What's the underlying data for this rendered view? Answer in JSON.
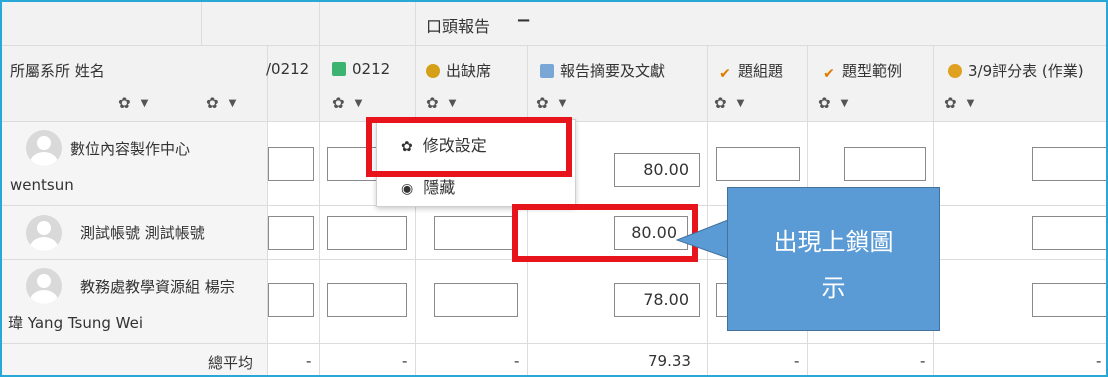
{
  "header": {
    "category_title": "口頭報告",
    "category_toggle": "−",
    "col_user_label": "所屬系所 姓名",
    "columns": [
      {
        "label": "/0212",
        "icon": "partial-label"
      },
      {
        "label": "0212",
        "icon": "forum-icon"
      },
      {
        "label": "出缺席",
        "icon": "attendance-icon"
      },
      {
        "label": "報告摘要及文獻",
        "icon": "assignment-icon"
      },
      {
        "label": "題組題",
        "icon": "quiz-icon"
      },
      {
        "label": "題型範例",
        "icon": "quiz-icon"
      },
      {
        "label": "3/9評分表 (作業)",
        "icon": "workshop-icon"
      }
    ],
    "gear_icon": "gear-icon",
    "caret_icon": "caret-down-icon"
  },
  "rows": [
    {
      "name_line1": "數位內容製作中心",
      "name_line2": "wentsun",
      "grade": "80.00"
    },
    {
      "name_line1": "測試帳號 測試帳號",
      "name_line2": "",
      "grade": "80.00"
    },
    {
      "name_line1": "教務處教學資源組 楊宗",
      "name_line2": "瑋 Yang Tsung Wei",
      "grade": "78.00"
    }
  ],
  "footer": {
    "label": "總平均",
    "values": [
      "-",
      "-",
      "-",
      "79.33",
      "-",
      "-",
      "-"
    ]
  },
  "menu": {
    "items": [
      {
        "label": "修改設定",
        "icon": "gear-icon"
      },
      {
        "label": "隱藏",
        "icon": "eye-icon"
      }
    ]
  },
  "callout": {
    "line1": "出現上鎖圖",
    "line2": "示"
  },
  "colors": {
    "frame": "#29a8d8",
    "highlight": "#e8141b",
    "callout": "#5b9bd5"
  }
}
